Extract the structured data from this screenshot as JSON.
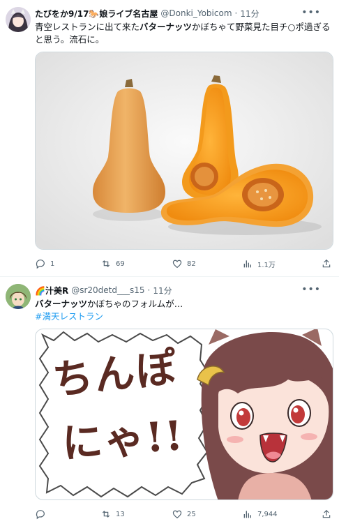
{
  "tweets": [
    {
      "display_name": "たびをか9/17🐎娘ライブ名古屋",
      "handle": "@Donki_Yobicom",
      "separator": "·",
      "time": "11分",
      "text_part1": "青空レストランに出て来た",
      "text_bold": "バターナッツ",
      "text_part2": "かぼちゃて野菜見た目チ○ポ過ぎると思う。流石に。",
      "media_alt": "butternut squash photo",
      "stats": {
        "replies": "1",
        "retweets": "69",
        "likes": "82",
        "views": "1.1万"
      }
    },
    {
      "display_name": "🌈汁美R",
      "handle": "@sr20detd___s15",
      "separator": "·",
      "time": "11分",
      "text_bold": "バターナッツ",
      "text_part2": "かぼちゃのフォルムが…",
      "hashtag": "#満天レストラン",
      "media_caption_line1": "ちんぽ",
      "media_caption_line2": "にゃ!!",
      "stats": {
        "replies": "",
        "retweets": "13",
        "likes": "25",
        "views": "7,944"
      }
    }
  ],
  "icons": {
    "more": "more-icon",
    "reply": "reply-icon",
    "retweet": "retweet-icon",
    "like": "heart-icon",
    "views": "views-icon",
    "share": "share-icon"
  },
  "colors": {
    "accent": "#1d9bf0",
    "text": "#0f1419",
    "muted": "#536471",
    "border": "#eff3f4",
    "squash": "#e9a24a"
  }
}
